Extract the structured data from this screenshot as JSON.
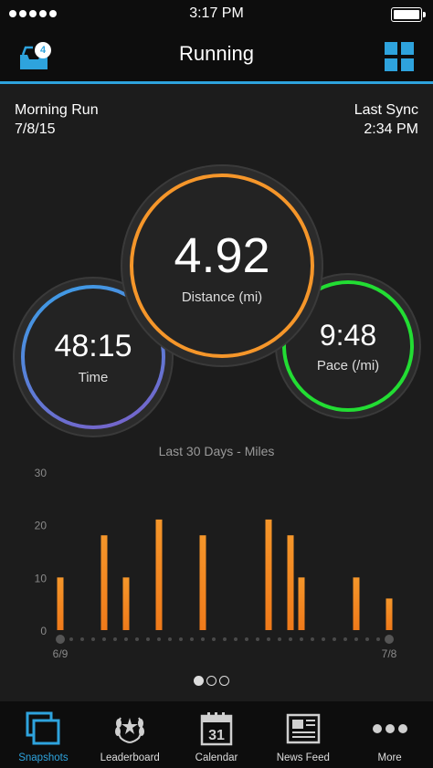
{
  "status": {
    "time": "3:17 PM"
  },
  "nav": {
    "title": "Running",
    "inbox_count": "4"
  },
  "activity": {
    "name": "Morning Run",
    "date": "7/8/15"
  },
  "sync": {
    "label": "Last Sync",
    "time": "2:34 PM"
  },
  "metrics": {
    "distance": {
      "value": "4.92",
      "label": "Distance (mi)",
      "color": "#f5962a"
    },
    "time": {
      "value": "48:15",
      "label": "Time",
      "color_start": "#3aa0e8",
      "color_end": "#7a5fc8"
    },
    "pace": {
      "value": "9:48",
      "label": "Pace (/mi)",
      "color": "#22dd33"
    }
  },
  "chart_data": {
    "type": "bar",
    "title": "Last 30 Days - Miles",
    "ylim": [
      0,
      30
    ],
    "yticks": [
      "30",
      "20",
      "10",
      "0"
    ],
    "x_start_label": "6/9",
    "x_end_label": "7/8",
    "days": 30,
    "values": [
      10,
      0,
      0,
      0,
      18,
      0,
      10,
      0,
      0,
      21,
      0,
      0,
      0,
      18,
      0,
      0,
      0,
      0,
      0,
      21,
      0,
      18,
      10,
      0,
      0,
      0,
      0,
      10,
      0,
      0,
      6
    ],
    "bar_color_top": "#f5962a",
    "bar_color_bottom": "#f07a1a"
  },
  "pager": {
    "pages": 3,
    "active": 0
  },
  "tabs": [
    {
      "label": "Snapshots",
      "icon": "snapshots-icon"
    },
    {
      "label": "Leaderboard",
      "icon": "laurel-icon"
    },
    {
      "label": "Calendar",
      "icon": "calendar-icon",
      "day": "31"
    },
    {
      "label": "News Feed",
      "icon": "newspaper-icon"
    },
    {
      "label": "More",
      "icon": "more-icon"
    }
  ],
  "colors": {
    "accent": "#2ea3dd",
    "background": "#1c1c1c",
    "bar": "#0d0d0d"
  }
}
